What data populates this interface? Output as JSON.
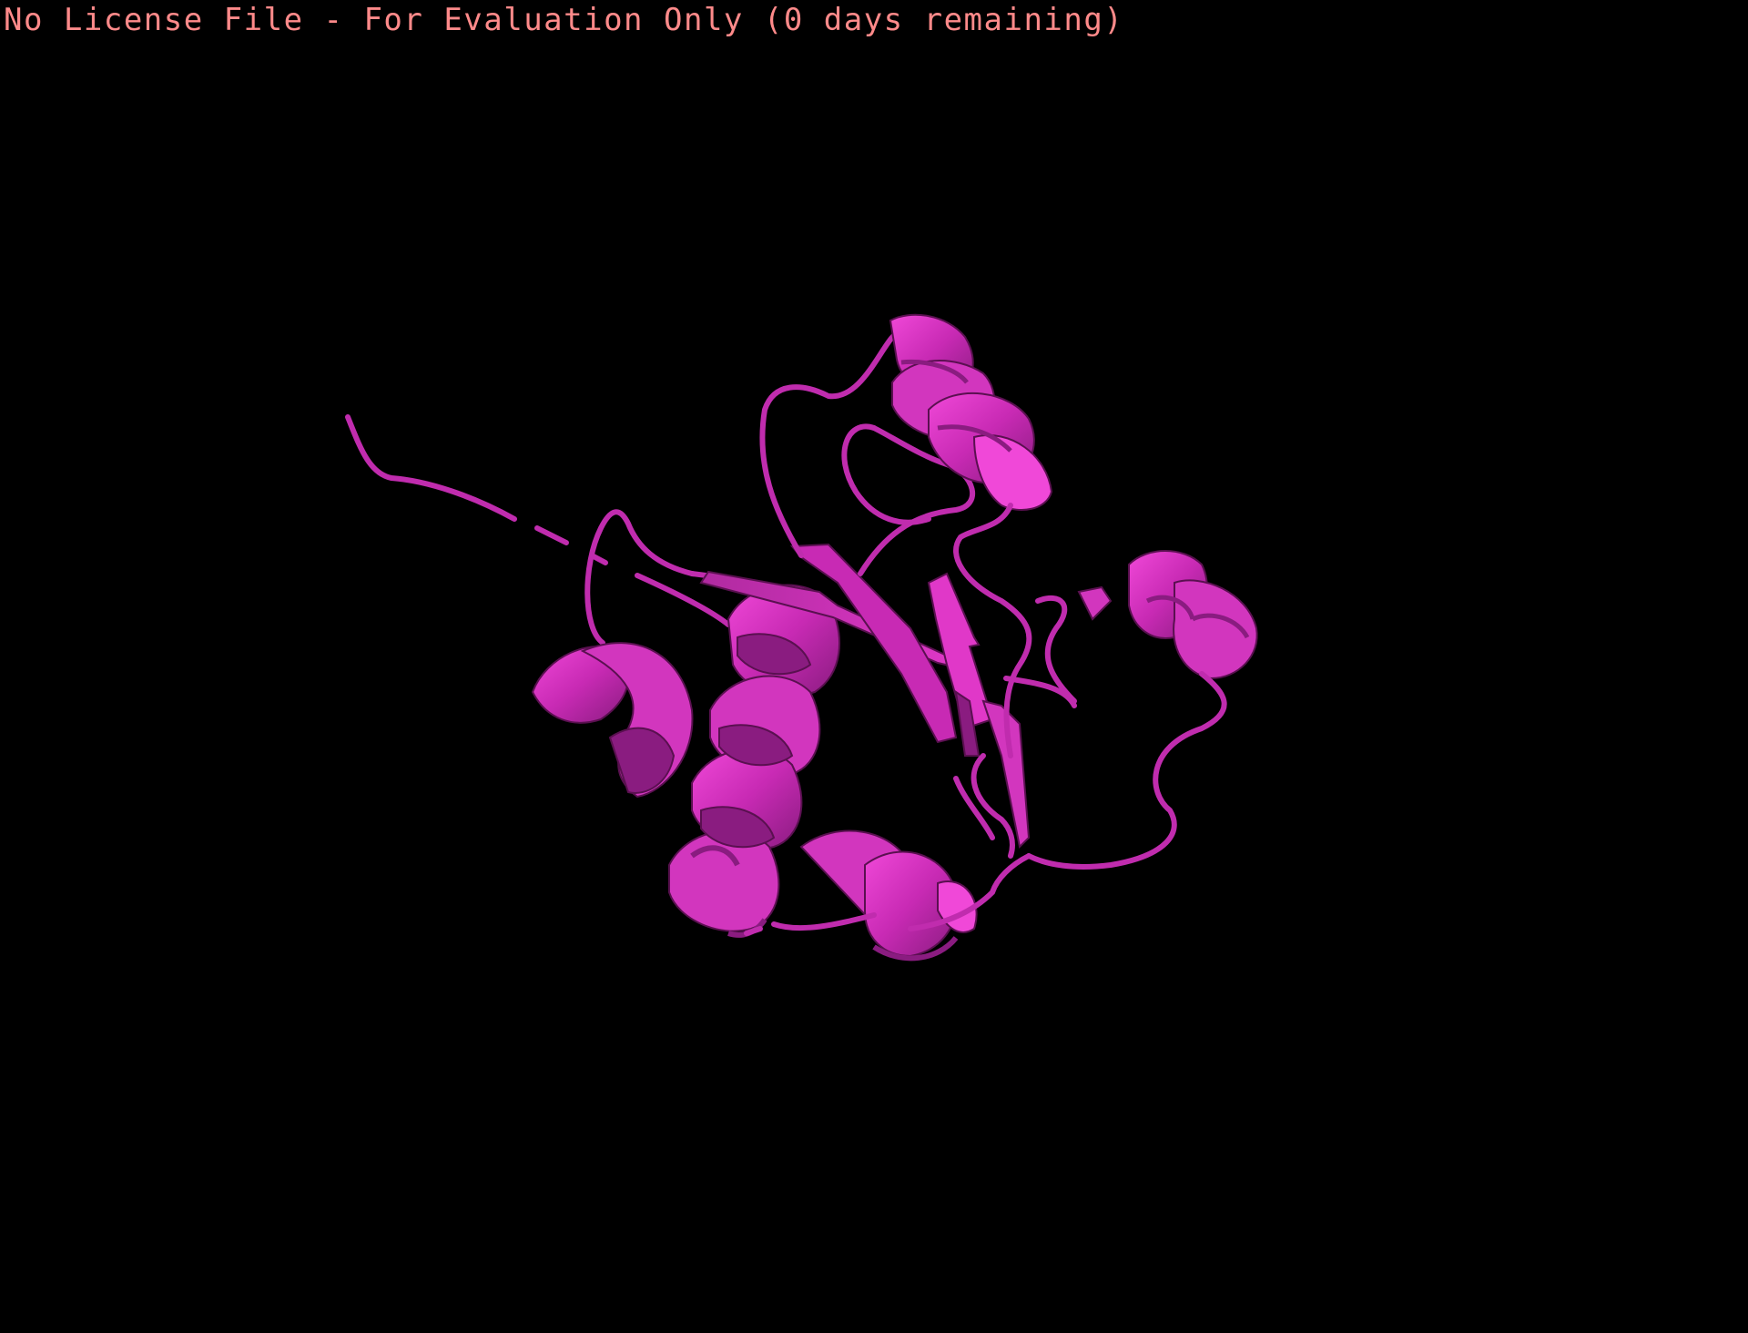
{
  "banner": {
    "text": "No License File - For Evaluation Only (0 days remaining)",
    "color": "#ff8a8a"
  },
  "viewport": {
    "background": "#000000",
    "representation": "cartoon",
    "cartoon_color": "#c82ab4",
    "highlight_color": "#f040d8",
    "shadow_color": "#7a1870"
  }
}
